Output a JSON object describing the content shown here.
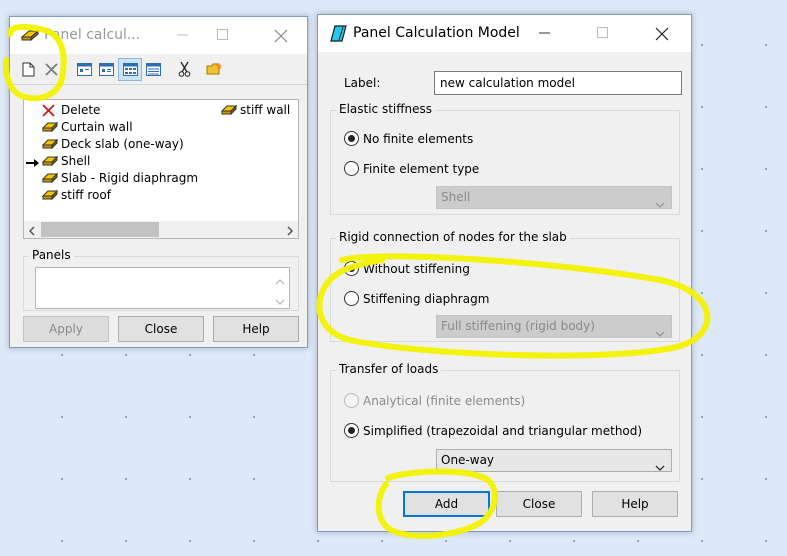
{
  "left_window": {
    "title": "Panel calcul...",
    "toolbar": {
      "icons": [
        "new-icon",
        "delete-x-icon",
        "list-view-icon",
        "details-view-icon",
        "grid-view-icon",
        "table-view-icon",
        "scissors-icon",
        "folder-star-icon"
      ]
    },
    "list_items": [
      {
        "label": "Delete",
        "icon": "delete-x-icon"
      },
      {
        "label": "Curtain wall",
        "icon": "slab-icon"
      },
      {
        "label": "Deck slab (one-way)",
        "icon": "slab-icon"
      },
      {
        "label": "Shell",
        "icon": "slab-icon",
        "current": true
      },
      {
        "label": "Slab - Rigid diaphragm",
        "icon": "slab-icon"
      },
      {
        "label": "stiff roof",
        "icon": "slab-icon"
      },
      {
        "label": "stiff wall",
        "icon": "slab-icon"
      }
    ],
    "panels_label": "Panels",
    "panels_value": "",
    "buttons": {
      "apply": "Apply",
      "close": "Close",
      "help": "Help"
    }
  },
  "right_window": {
    "title": "Panel Calculation Model",
    "label_caption": "Label:",
    "label_value": "new calculation model",
    "elastic": {
      "title": "Elastic stiffness",
      "option_no_fe": "No finite elements",
      "option_fe_type": "Finite element type",
      "selected": "No finite elements",
      "fe_type_value": "Shell"
    },
    "rigid": {
      "title": "Rigid connection of nodes for the slab",
      "option_without": "Without stiffening",
      "option_diaphragm": "Stiffening diaphragm",
      "selected": "Without stiffening",
      "diaphragm_value": "Full stiffening (rigid body)"
    },
    "transfer": {
      "title": "Transfer of loads",
      "option_analytical": "Analytical (finite elements)",
      "option_simplified": "Simplified (trapezoidal and triangular method)",
      "selected": "Simplified (trapezoidal and triangular method)",
      "direction_value": "One-way"
    },
    "buttons": {
      "add": "Add",
      "close": "Close",
      "help": "Help"
    }
  },
  "colors": {
    "highlight": "#f2f200",
    "accent": "#0078d7",
    "desktop": "#dde8f8"
  }
}
